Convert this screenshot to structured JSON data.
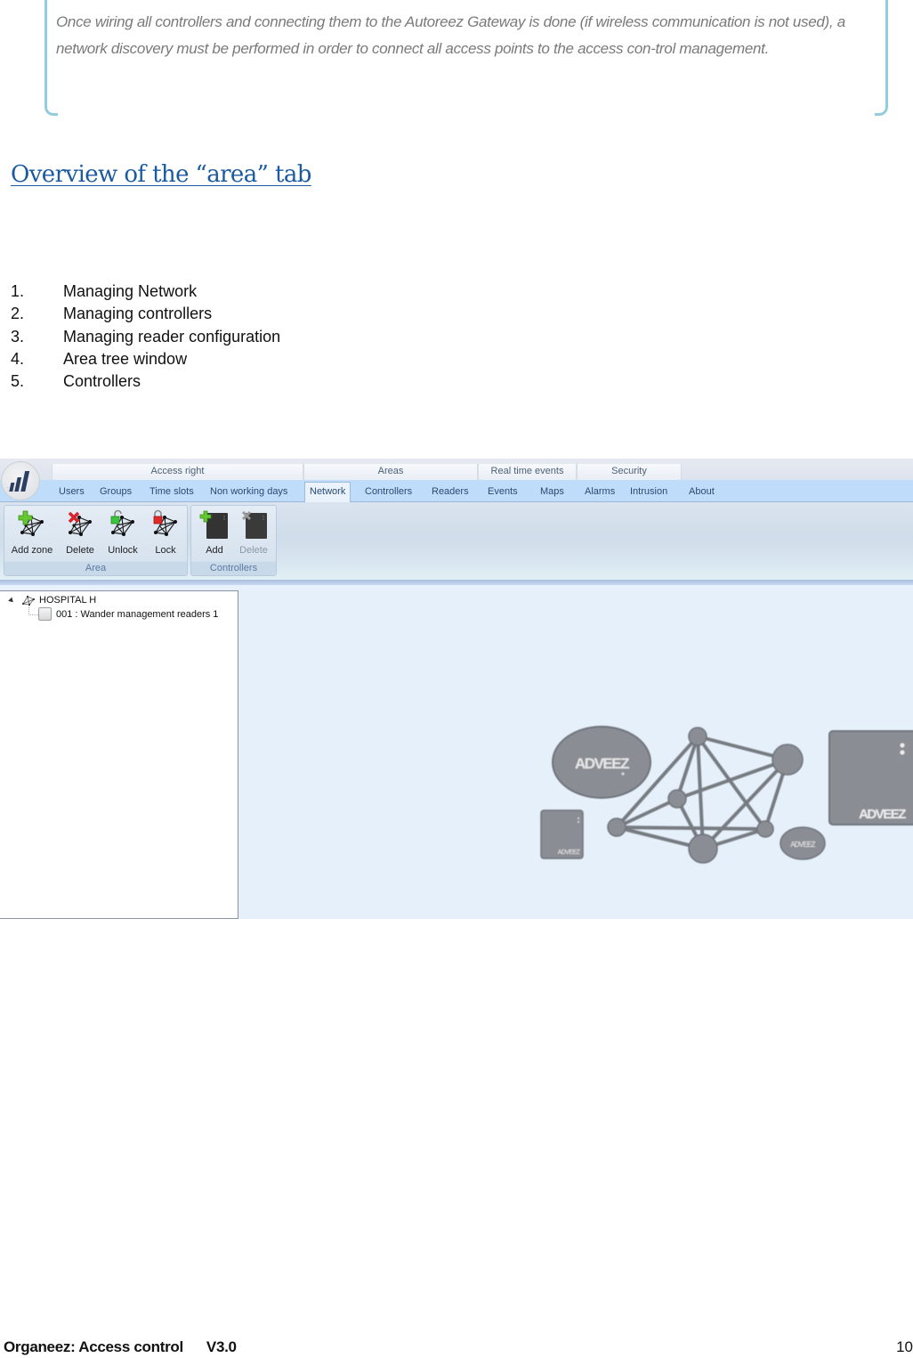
{
  "callout": {
    "text": "Once wiring all controllers and connecting them to the Autoreez Gateway is done (if wireless communication is not used), a network discovery must be performed in order to connect all access points to the access con-trol management.",
    "border_color": "#93cddd"
  },
  "heading": "Overview of the “area” tab",
  "list": [
    {
      "num": "1.",
      "text": "Managing Network"
    },
    {
      "num": "2.",
      "text": "Managing controllers"
    },
    {
      "num": "3.",
      "text": "Managing reader configuration"
    },
    {
      "num": "4.",
      "text": "Area tree window"
    },
    {
      "num": "5.",
      "text": "Controllers"
    }
  ],
  "app": {
    "logo_icon": "signal-bars-icon",
    "tab_groups": [
      {
        "label": "Access right"
      },
      {
        "label": "Areas"
      },
      {
        "label": "Real time events"
      },
      {
        "label": "Security"
      }
    ],
    "tabs": [
      {
        "label": "Users"
      },
      {
        "label": "Groups"
      },
      {
        "label": "Time slots"
      },
      {
        "label": "Non working days"
      },
      {
        "label": "Network",
        "active": true
      },
      {
        "label": "Controllers"
      },
      {
        "label": "Readers"
      },
      {
        "label": "Events"
      },
      {
        "label": "Maps"
      },
      {
        "label": "Alarms"
      },
      {
        "label": "Intrusion"
      },
      {
        "label": "About"
      }
    ],
    "ribbon": {
      "area_group": {
        "label": "Area",
        "buttons": [
          {
            "label": "Add zone",
            "icon": "add-zone-icon"
          },
          {
            "label": "Delete",
            "icon": "delete-zone-icon"
          },
          {
            "label": "Unlock",
            "icon": "unlock-zone-icon"
          },
          {
            "label": "Lock",
            "icon": "lock-zone-icon"
          }
        ]
      },
      "controllers_group": {
        "label": "Controllers",
        "buttons": [
          {
            "label": "Add",
            "icon": "add-controller-icon",
            "enabled": true
          },
          {
            "label": "Delete",
            "icon": "delete-controller-icon",
            "enabled": false
          }
        ]
      }
    },
    "tree": {
      "root": {
        "label": "HOSPITAL H",
        "expanded": true
      },
      "children": [
        {
          "label": "001 : Wander management readers 1"
        }
      ]
    },
    "canvas": {
      "brand_text": "ADVEEZ"
    }
  },
  "footer": {
    "title": "Organeez: Access control",
    "version": "V3.0",
    "page": "10"
  }
}
